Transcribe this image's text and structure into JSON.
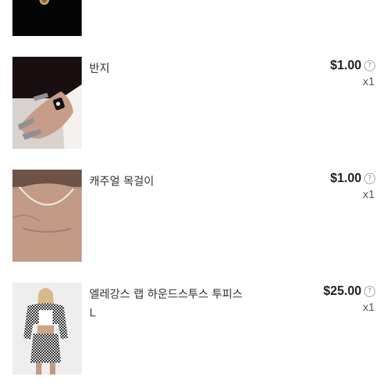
{
  "items": [
    {
      "name": "",
      "variant": "",
      "price": "",
      "qty": "",
      "image": "black-thumbnail-with-gold-emblem"
    },
    {
      "name": "반지",
      "variant": "",
      "price": "$1.00",
      "qty": "x1",
      "image": "hand-wearing-black-ring"
    },
    {
      "name": "캐주얼 목걸이",
      "variant": "",
      "price": "$1.00",
      "qty": "x1",
      "image": "neck-wearing-silver-chain"
    },
    {
      "name": "엘레강스 랩 하운드스투스 투피스",
      "variant": "L",
      "price": "$25.00",
      "qty": "x1",
      "image": "woman-in-houndstooth-two-piece"
    }
  ],
  "icons": {
    "price_help": "question-circle-icon",
    "help_glyph": "?"
  },
  "colors": {
    "text": "#333333",
    "price": "#222222",
    "muted": "#9a9a9a"
  }
}
